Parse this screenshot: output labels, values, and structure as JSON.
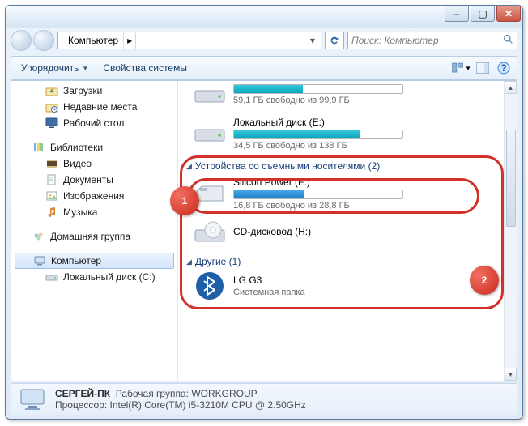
{
  "titlebar": {
    "min": "–",
    "max": "▢",
    "close": "✕"
  },
  "address": {
    "location": "Компьютер",
    "arrow": "▸",
    "dd": "▾"
  },
  "search": {
    "placeholder": "Поиск: Компьютер"
  },
  "toolbar": {
    "organize": "Упорядочить",
    "sysprops": "Свойства системы"
  },
  "nav": {
    "downloads": "Загрузки",
    "recent": "Недавние места",
    "desktop": "Рабочий стол",
    "libraries": "Библиотеки",
    "videos": "Видео",
    "documents": "Документы",
    "pictures": "Изображения",
    "music": "Музыка",
    "homegroup": "Домашняя группа",
    "computer": "Компьютер",
    "localc": "Локальный диск (C:)"
  },
  "drives": {
    "top_free": "59,1 ГБ свободно из 99,9 ГБ",
    "e_name": "Локальный диск (E:)",
    "e_free": "34,5 ГБ свободно из 138 ГБ",
    "group_removable": "Устройства со съемными носителями (2)",
    "f_name": "Silicon Power (F:)",
    "f_free": "16,8 ГБ свободно из 28,8 ГБ",
    "cd_name": "CD-дисковод (H:)",
    "group_other": "Другие (1)",
    "lg_name": "LG G3",
    "lg_sub": "Системная папка"
  },
  "status": {
    "pcname": "СЕРГЕЙ-ПК",
    "wg_label": "Рабочая группа:",
    "wg_value": "WORKGROUP",
    "cpu_label": "Процессор:",
    "cpu_value": "Intel(R) Core(TM) i5-3210M CPU @ 2.50GHz"
  },
  "annot": {
    "one": "1",
    "two": "2"
  }
}
